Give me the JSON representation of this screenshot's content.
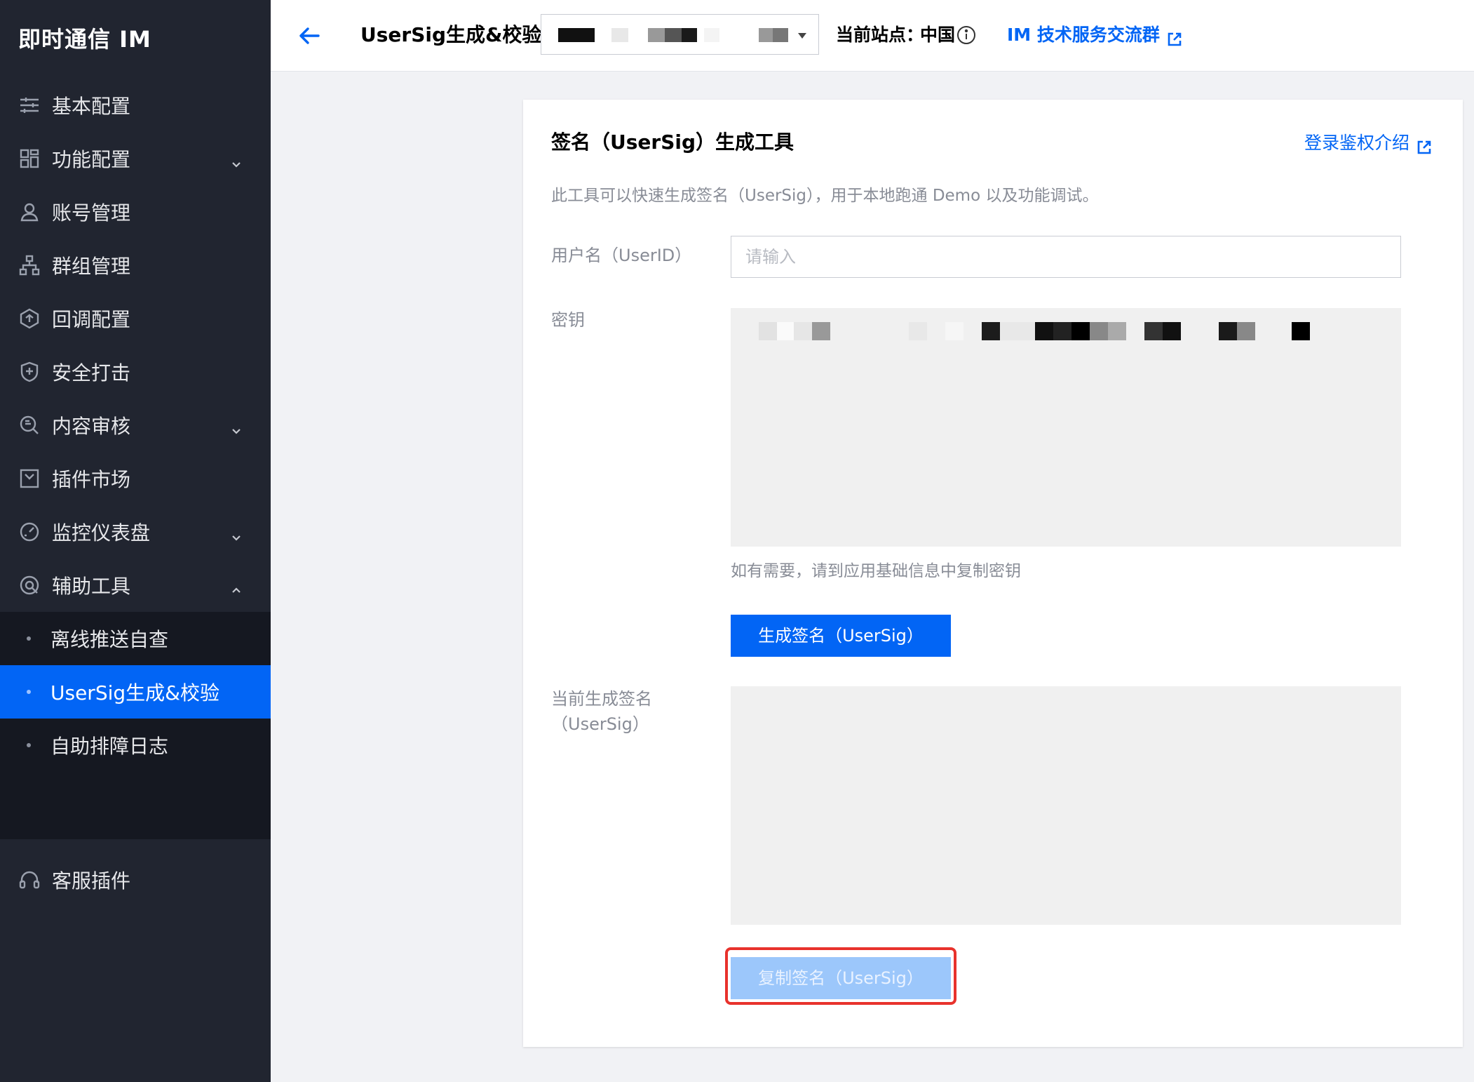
{
  "sidebar": {
    "brand": "即时通信 IM",
    "items": [
      {
        "label": "基本配置",
        "icon": "sliders-icon"
      },
      {
        "label": "功能配置",
        "icon": "grid-icon",
        "expandable": true
      },
      {
        "label": "账号管理",
        "icon": "user-icon"
      },
      {
        "label": "群组管理",
        "icon": "org-chart-icon"
      },
      {
        "label": "回调配置",
        "icon": "callback-icon"
      },
      {
        "label": "安全打击",
        "icon": "shield-icon"
      },
      {
        "label": "内容审核",
        "icon": "audit-search-icon",
        "expandable": true
      },
      {
        "label": "插件市场",
        "icon": "plugin-market-icon"
      },
      {
        "label": "监控仪表盘",
        "icon": "gauge-icon",
        "expandable": true
      },
      {
        "label": "辅助工具",
        "icon": "tools-icon",
        "expanded": true
      }
    ],
    "subitems": [
      {
        "label": "离线推送自查"
      },
      {
        "label": "UserSig生成&校验",
        "active": true
      },
      {
        "label": "自助排障日志"
      }
    ],
    "bottom_item": {
      "label": "客服插件",
      "icon": "headset-icon"
    }
  },
  "header": {
    "title": "UserSig生成&校验",
    "site_label": "当前站点：",
    "site_value": "中国",
    "im_link": "IM 技术服务交流群"
  },
  "card": {
    "title": "签名（UserSig）生成工具",
    "auth_link": "登录鉴权介绍",
    "description": "此工具可以快速生成签名（UserSig），用于本地跑通 Demo 以及功能调试。",
    "userid_label": "用户名（UserID）",
    "userid_placeholder": "请输入",
    "key_label": "密钥",
    "key_hint": "如有需要，请到应用基础信息中复制密钥",
    "generate_button": "生成签名（UserSig）",
    "current_sig_label_line1": "当前生成签名",
    "current_sig_label_line2": "（UserSig）",
    "copy_button": "复制签名（UserSig）"
  },
  "colors": {
    "sidebar_bg": "#212530",
    "submenu_bg": "#151821",
    "accent": "#0265f5",
    "copy_button_disabled": "#9cc7fb",
    "highlight": "#e8322c"
  }
}
